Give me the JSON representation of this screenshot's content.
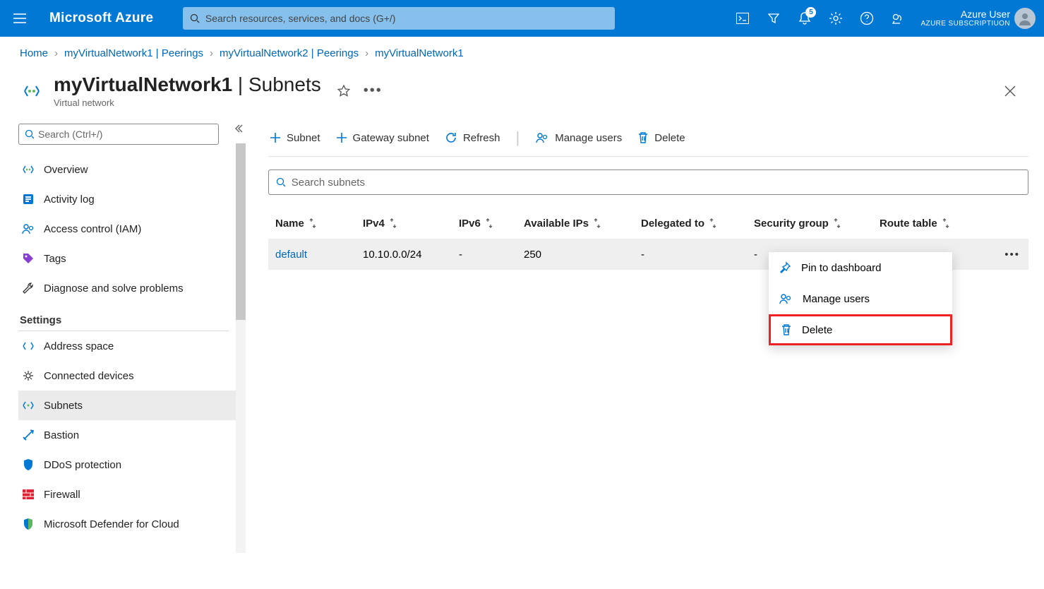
{
  "brand": "Microsoft Azure",
  "search": {
    "placeholder": "Search resources, services, and docs (G+/)"
  },
  "user": {
    "name": "Azure User",
    "subscription": "AZURE SUBSCRIPTIUON"
  },
  "notifications": {
    "count": "5"
  },
  "breadcrumb": [
    {
      "label": "Home"
    },
    {
      "label": "myVirtualNetwork1 | Peerings"
    },
    {
      "label": "myVirtualNetwork2 | Peerings"
    },
    {
      "label": "myVirtualNetwork1"
    }
  ],
  "page": {
    "title": "myVirtualNetwork1",
    "suffix": " | Subnets",
    "subtitle": "Virtual network"
  },
  "sidebar": {
    "search_placeholder": "Search (Ctrl+/)",
    "items_top": [
      {
        "label": "Overview"
      },
      {
        "label": "Activity log"
      },
      {
        "label": "Access control (IAM)"
      },
      {
        "label": "Tags"
      },
      {
        "label": "Diagnose and solve problems"
      }
    ],
    "section": "Settings",
    "items_settings": [
      {
        "label": "Address space"
      },
      {
        "label": "Connected devices"
      },
      {
        "label": "Subnets"
      },
      {
        "label": "Bastion"
      },
      {
        "label": "DDoS protection"
      },
      {
        "label": "Firewall"
      },
      {
        "label": "Microsoft Defender for Cloud"
      }
    ]
  },
  "toolbar": {
    "subnet": "Subnet",
    "gateway": "Gateway subnet",
    "refresh": "Refresh",
    "manage": "Manage users",
    "delete": "Delete"
  },
  "subnets": {
    "search_placeholder": "Search subnets",
    "columns": [
      "Name",
      "IPv4",
      "IPv6",
      "Available IPs",
      "Delegated to",
      "Security group",
      "Route table"
    ],
    "rows": [
      {
        "name": "default",
        "ipv4": "10.10.0.0/24",
        "ipv6": "-",
        "available": "250",
        "delegated": "-",
        "security": "-",
        "route": ""
      }
    ]
  },
  "context_menu": {
    "pin": "Pin to dashboard",
    "manage": "Manage users",
    "delete": "Delete"
  }
}
